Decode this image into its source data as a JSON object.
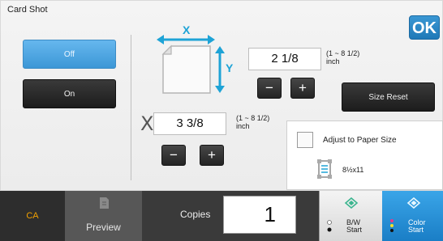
{
  "screen": {
    "title": "Card Shot",
    "ok_label": "OK"
  },
  "mode": {
    "off_label": "Off",
    "on_label": "On",
    "selected": "Off"
  },
  "dimensions": {
    "y_value": "2 1/8",
    "y_range": "(1 ~ 8 1/2)",
    "y_unit": "inch",
    "x_value": "3 3/8",
    "x_range": "(1 ~ 8 1/2)",
    "x_unit": "inch",
    "x_axis_label": "X",
    "figure_x_label": "X",
    "figure_y_label": "Y",
    "minus_label": "−",
    "plus_label": "+"
  },
  "size_reset_label": "Size Reset",
  "adjust": {
    "label": "Adjust to Paper Size",
    "checked": false,
    "paper_size": "8½x11"
  },
  "bottom_bar": {
    "ca_label": "CA",
    "preview_label": "Preview",
    "copies_label": "Copies",
    "copies_value": "1",
    "bw_line1": "B/W",
    "bw_line2": "Start",
    "color_line1": "Color",
    "color_line2": "Start"
  },
  "colors": {
    "accent_blue": "#3c97d6",
    "ca_text": "#f2a100",
    "arrow_cyan": "#1ea3d6"
  },
  "icons": [
    "card-figure-icon",
    "x-arrow-icon",
    "y-arrow-icon",
    "checkbox-icon",
    "paper-size-icon",
    "preview-icon",
    "start-diamond-icon",
    "color-dots-icon"
  ]
}
